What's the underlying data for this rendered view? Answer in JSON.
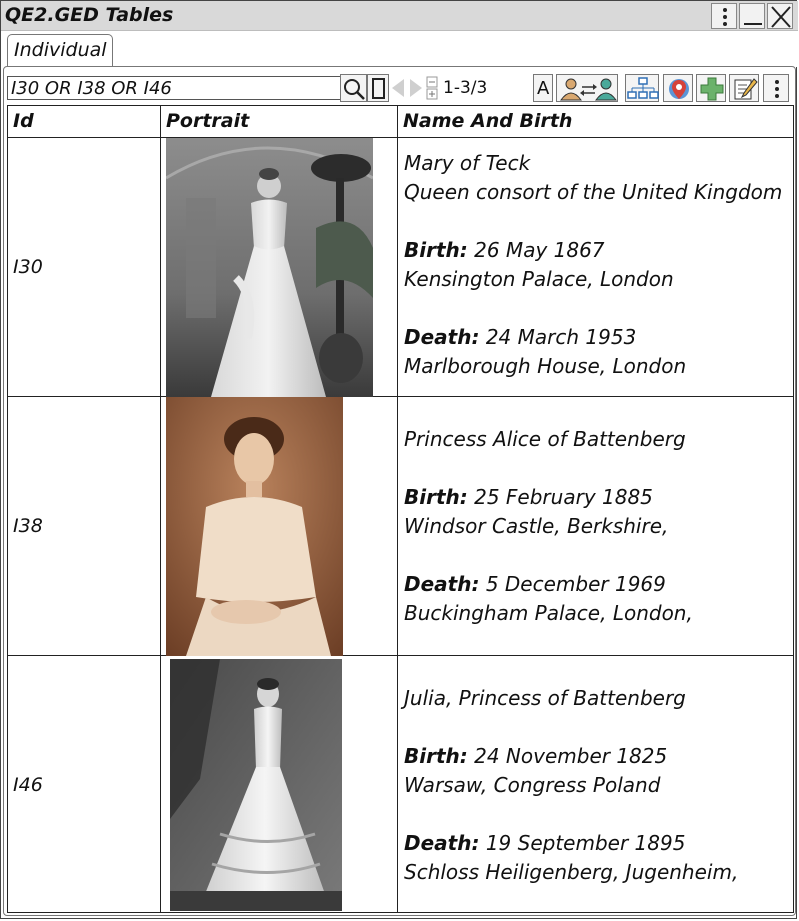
{
  "window": {
    "title": "QE2.GED Tables"
  },
  "tabs": [
    {
      "label": "Individual"
    }
  ],
  "toolbar": {
    "search_value": "I30 OR I38 OR I46",
    "range_label": "1-3/3",
    "text_mode_label": "A"
  },
  "table": {
    "columns": [
      "Id",
      "Portrait",
      "Name And Birth"
    ],
    "rows": [
      {
        "id": "I30",
        "name": "Mary of Teck",
        "title": "Queen consort of the United Kingdom",
        "birth_label": "Birth:",
        "birth_date": "26 May 1867",
        "birth_place": "Kensington Palace, London",
        "death_label": "Death:",
        "death_date": "24 March 1953",
        "death_place": "Marlborough House, London"
      },
      {
        "id": "I38",
        "name": "Princess Alice of Battenberg",
        "birth_label": "Birth:",
        "birth_date": "25 February 1885",
        "birth_place": "Windsor Castle, Berkshire,",
        "death_label": "Death:",
        "death_date": "5 December 1969",
        "death_place": "Buckingham Palace, London,"
      },
      {
        "id": "I46",
        "name": "Julia, Princess of Battenberg",
        "birth_label": "Birth:",
        "birth_date": "24 November 1825",
        "birth_place": "Warsaw, Congress Poland",
        "death_label": "Death:",
        "death_date": "19 September 1895",
        "death_place": "Schloss Heiligenberg, Jugenheim,"
      }
    ]
  },
  "icons": {
    "window": [
      "more-vertical-icon",
      "minimize-icon",
      "close-icon"
    ],
    "toolbar": [
      "search-icon",
      "single-record-icon",
      "prev-icon",
      "next-icon",
      "filter-toggle-icon",
      "text-mode-icon",
      "relate-persons-icon",
      "tree-chart-icon",
      "map-pin-icon",
      "add-icon",
      "edit-icon",
      "more-vertical-icon"
    ]
  },
  "colors": {
    "titlebar": "#d9d9d9",
    "add_green": "#6bb26b",
    "person_tan": "#d9a870",
    "person_teal": "#4aa99a",
    "tree_blue": "#2f6fb5",
    "map_red": "#d6423a"
  }
}
